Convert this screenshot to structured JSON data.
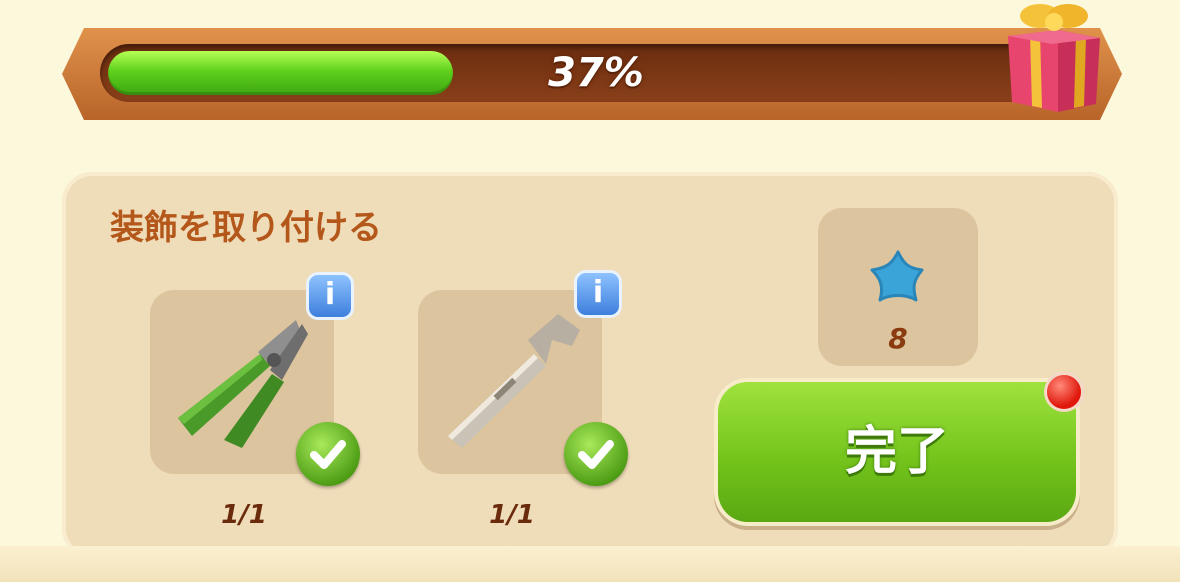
{
  "progress": {
    "value": 0.37,
    "label": "37%"
  },
  "task": {
    "title": "装飾を取り付ける",
    "items": [
      {
        "name": "pliers",
        "icon": "pliers-icon",
        "count": "1/1",
        "completed": true
      },
      {
        "name": "wrench",
        "icon": "wrench-icon",
        "count": "1/1",
        "completed": true
      }
    ],
    "reward": {
      "icon": "blue-star-icon",
      "count": "8"
    },
    "complete_button": {
      "label": "完了"
    }
  },
  "colors": {
    "title_brown": "#b4571a",
    "progress_green": "#5fd11d",
    "button_green": "#74c41c",
    "info_blue": "#3d7fdc",
    "panel_beige": "#efdcb8"
  }
}
